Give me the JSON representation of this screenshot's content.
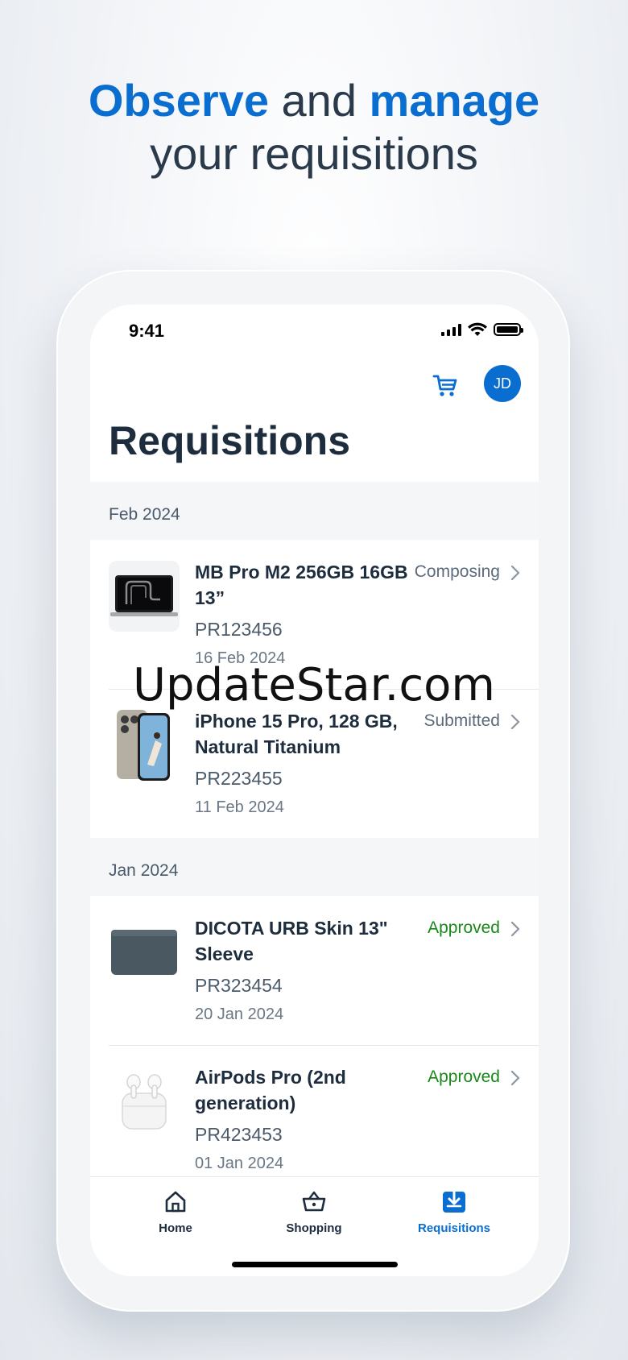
{
  "headline": {
    "word1": "Observe",
    "word2": " and ",
    "word3": "manage",
    "line2": "your requisitions"
  },
  "status_bar": {
    "time": "9:41"
  },
  "header": {
    "avatar_initials": "JD",
    "title": "Requisitions"
  },
  "groups": [
    {
      "label": "Feb 2024",
      "items": [
        {
          "title": "MB Pro M2 256GB 16GB 13”",
          "id": "PR123456",
          "date": "16 Feb 2024",
          "status": "Composing"
        },
        {
          "title": "iPhone 15 Pro, 128 GB, Natural Titanium",
          "id": "PR223455",
          "date": "11 Feb 2024",
          "status": "Submitted"
        }
      ]
    },
    {
      "label": "Jan 2024",
      "items": [
        {
          "title": "DICOTA URB Skin 13\" Sleeve",
          "id": "PR323454",
          "date": "20 Jan 2024",
          "status": "Approved"
        },
        {
          "title": "AirPods Pro (2nd generation)",
          "id": "PR423453",
          "date": "01 Jan 2024",
          "status": "Approved"
        }
      ]
    }
  ],
  "tabbar": {
    "home": "Home",
    "shopping": "Shopping",
    "requisitions": "Requisitions"
  },
  "watermark": "UpdateStar.com",
  "colors": {
    "accent": "#0a6ed1",
    "approved": "#188918",
    "text": "#1d2d3e"
  }
}
